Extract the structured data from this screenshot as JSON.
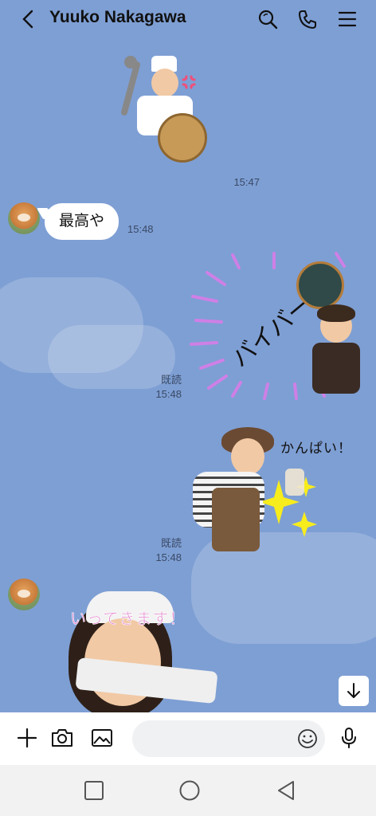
{
  "header": {
    "title": "Yuuko Nakagawa",
    "icons": [
      "chevron-left-icon",
      "search-icon",
      "phone-icon",
      "hamburger-menu-icon"
    ]
  },
  "messages": [
    {
      "type": "sticker",
      "side": "right",
      "description": "chef-with-ladle-and-plaque",
      "time": "15:47"
    },
    {
      "type": "text",
      "side": "left",
      "text": "最高や",
      "time": "15:48"
    },
    {
      "type": "sticker",
      "side": "right",
      "sticker_text": "バイバーイ",
      "read": "既読",
      "time": "15:48"
    },
    {
      "type": "sticker",
      "side": "right",
      "sticker_text": "かんぱい！",
      "read": "既読",
      "time": "15:48"
    },
    {
      "type": "sticker",
      "side": "left",
      "sticker_text": "いってきます！"
    }
  ],
  "input": {
    "placeholder": ""
  },
  "colors": {
    "chat_bg": "#7e9fd4",
    "bubble": "#ffffff",
    "sticker_pink": "#e58ad0"
  }
}
